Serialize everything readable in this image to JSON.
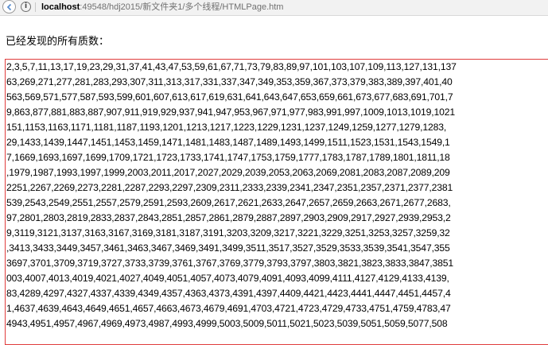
{
  "address_bar": {
    "url_host": "localhost",
    "url_rest": ":49548/hdj2015/新文件夹1/多个线程/HTMLPage.htm"
  },
  "heading": "已经发现的所有质数：",
  "primes_rows": [
    "2,3,5,7,11,13,17,19,23,29,31,37,41,43,47,53,59,61,67,71,73,79,83,89,97,101,103,107,109,113,127,131,137",
    "63,269,271,277,281,283,293,307,311,313,317,331,337,347,349,353,359,367,373,379,383,389,397,401,40",
    "563,569,571,577,587,593,599,601,607,613,617,619,631,641,643,647,653,659,661,673,677,683,691,701,7",
    "9,863,877,881,883,887,907,911,919,929,937,941,947,953,967,971,977,983,991,997,1009,1013,1019,1021",
    "151,1153,1163,1171,1181,1187,1193,1201,1213,1217,1223,1229,1231,1237,1249,1259,1277,1279,1283,",
    "29,1433,1439,1447,1451,1453,1459,1471,1481,1483,1487,1489,1493,1499,1511,1523,1531,1543,1549,1",
    "7,1669,1693,1697,1699,1709,1721,1723,1733,1741,1747,1753,1759,1777,1783,1787,1789,1801,1811,18",
    ",1979,1987,1993,1997,1999,2003,2011,2017,2027,2029,2039,2053,2063,2069,2081,2083,2087,2089,209",
    "2251,2267,2269,2273,2281,2287,2293,2297,2309,2311,2333,2339,2341,2347,2351,2357,2371,2377,2381",
    "539,2543,2549,2551,2557,2579,2591,2593,2609,2617,2621,2633,2647,2657,2659,2663,2671,2677,2683,",
    "97,2801,2803,2819,2833,2837,2843,2851,2857,2861,2879,2887,2897,2903,2909,2917,2927,2939,2953,2",
    "9,3119,3121,3137,3163,3167,3169,3181,3187,3191,3203,3209,3217,3221,3229,3251,3253,3257,3259,32",
    ",3413,3433,3449,3457,3461,3463,3467,3469,3491,3499,3511,3517,3527,3529,3533,3539,3541,3547,355",
    "3697,3701,3709,3719,3727,3733,3739,3761,3767,3769,3779,3793,3797,3803,3821,3823,3833,3847,3851",
    "003,4007,4013,4019,4021,4027,4049,4051,4057,4073,4079,4091,4093,4099,4111,4127,4129,4133,4139,",
    "83,4289,4297,4327,4337,4339,4349,4357,4363,4373,4391,4397,4409,4421,4423,4441,4447,4451,4457,4",
    "1,4637,4639,4643,4649,4651,4657,4663,4673,4679,4691,4703,4721,4723,4729,4733,4751,4759,4783,47",
    "4943,4951,4957,4967,4969,4973,4987,4993,4999,5003,5009,5011,5021,5023,5039,5051,5059,5077,508"
  ]
}
